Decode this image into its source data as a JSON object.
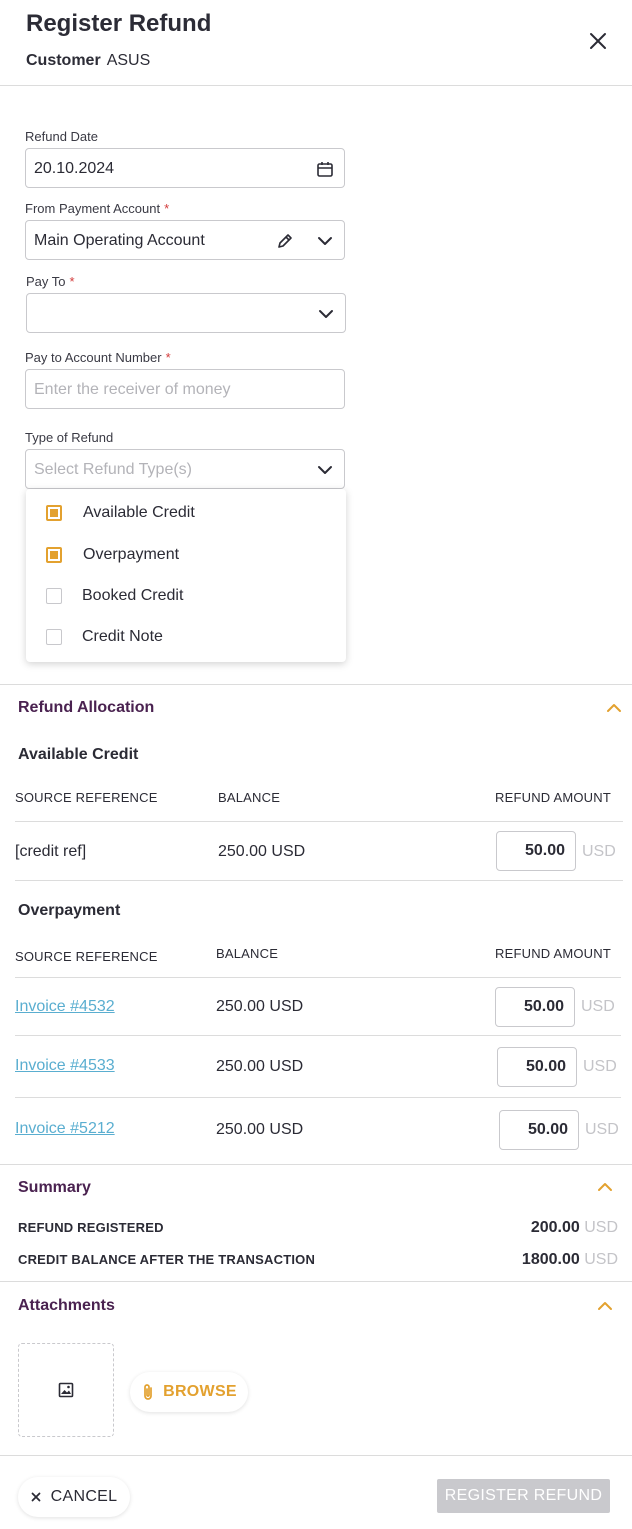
{
  "header": {
    "title": "Register Refund",
    "customer_label": "Customer",
    "customer_value": "ASUS"
  },
  "form": {
    "refund_date_label": "Refund Date",
    "refund_date_value": "20.10.2024",
    "from_account_label": "From Payment Account",
    "from_account_value": "Main Operating Account",
    "pay_to_label": "Pay To",
    "pay_to_value": "",
    "pay_to_account_label": "Pay to Account Number",
    "pay_to_account_placeholder": "Enter the receiver of money",
    "refund_type_label": "Type of Refund",
    "refund_type_placeholder": "Select Refund Type(s)",
    "required_mark": "*"
  },
  "refund_type_options": [
    {
      "label": "Available Credit",
      "checked": true
    },
    {
      "label": "Overpayment",
      "checked": true
    },
    {
      "label": "Booked Credit",
      "checked": false
    },
    {
      "label": "Credit Note",
      "checked": false
    }
  ],
  "allocation": {
    "title": "Refund Allocation",
    "columns": {
      "source": "SOURCE REFERENCE",
      "balance": "BALANCE",
      "refund": "REFUND AMOUNT"
    },
    "currency": "USD",
    "available_credit": {
      "title": "Available Credit",
      "rows": [
        {
          "source": "[credit ref]",
          "balance": "250.00 USD",
          "amount": "50.00"
        }
      ]
    },
    "overpayment": {
      "title": "Overpayment",
      "rows": [
        {
          "source": "Invoice #4532",
          "balance": "250.00 USD",
          "amount": "50.00"
        },
        {
          "source": "Invoice #4533",
          "balance": "250.00 USD",
          "amount": "50.00"
        },
        {
          "source": "Invoice #5212",
          "balance": "250.00 USD",
          "amount": "50.00"
        }
      ]
    }
  },
  "summary": {
    "title": "Summary",
    "refund_registered_label": "REFUND REGISTERED",
    "refund_registered_value": "200.00",
    "credit_balance_label": "CREDIT BALANCE AFTER THE TRANSACTION",
    "credit_balance_value": "1800.00",
    "currency": "USD"
  },
  "attachments": {
    "title": "Attachments",
    "browse_label": "BROWSE"
  },
  "footer": {
    "cancel_label": "CANCEL",
    "register_label": "REGISTER REFUND"
  },
  "colors": {
    "accent": "#e3a12f",
    "section_title": "#4a2250",
    "link": "#5aaed0",
    "required": "#d23a3a",
    "disabled_button": "#c9c9cd"
  }
}
